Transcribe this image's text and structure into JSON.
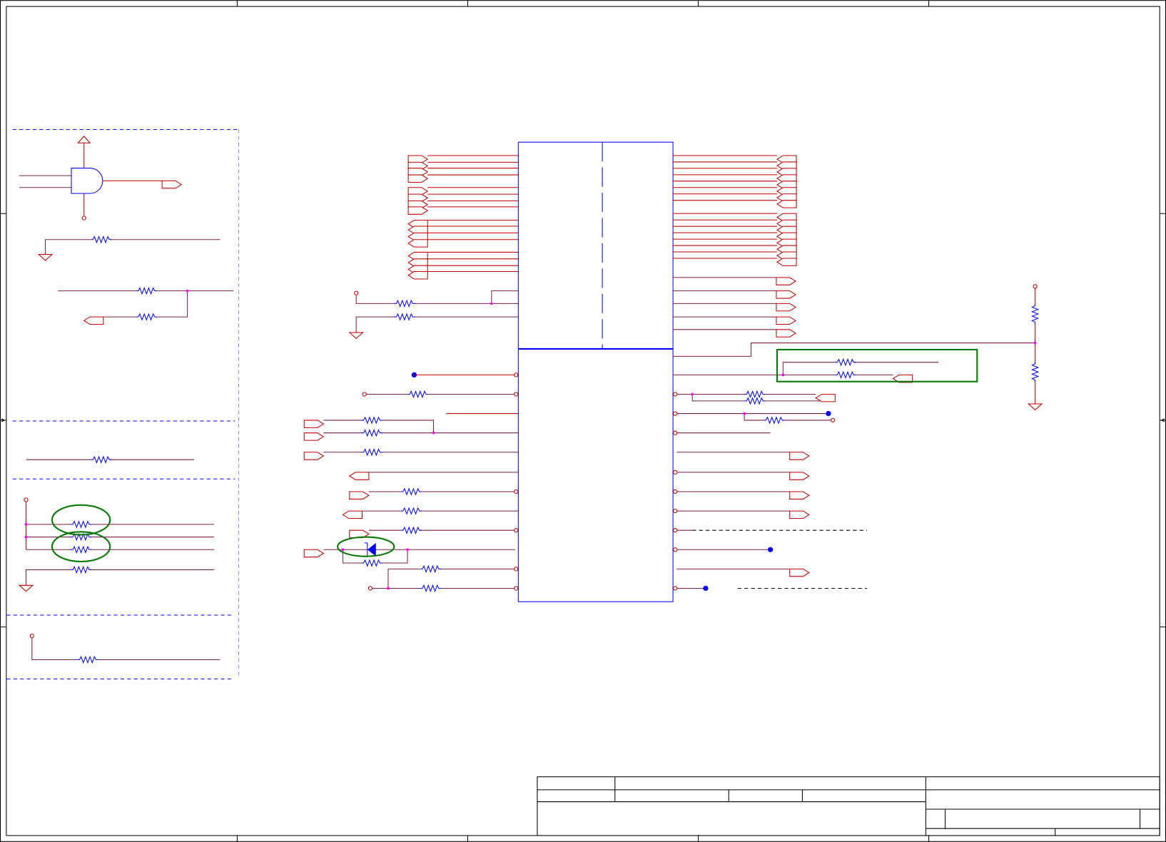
{
  "document": {
    "type": "schematic-sheet",
    "visible_text": []
  },
  "colors": {
    "wire": "#c00000",
    "net": "#7a1f4a",
    "component": "#0000ff",
    "highlight": "#007700",
    "junction": "#ff00ff",
    "frame": "#000000"
  },
  "legend": {
    "icons": [
      "and-gate-icon",
      "resistor-icon",
      "ground-icon",
      "power-pin-icon",
      "port-connector-icon",
      "diode-icon",
      "junction-dot-icon"
    ]
  },
  "title_block": {
    "cells": []
  }
}
